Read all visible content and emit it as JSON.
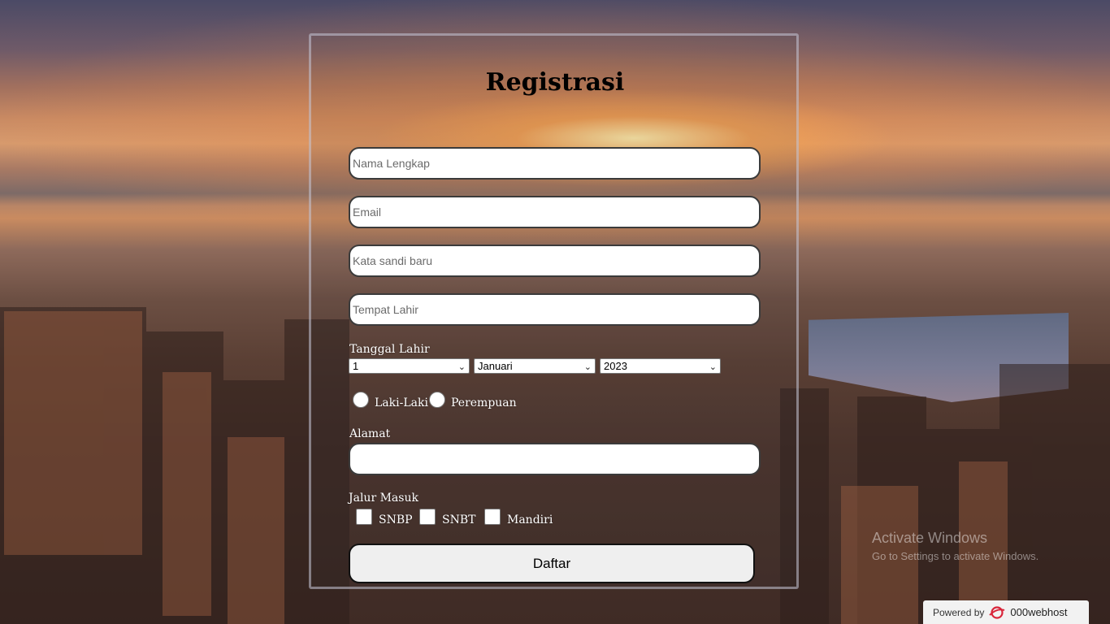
{
  "form": {
    "title": "Registrasi",
    "full_name_placeholder": "Nama Lengkap",
    "email_placeholder": "Email",
    "password_placeholder": "Kata sandi baru",
    "birthplace_placeholder": "Tempat Lahir",
    "birthdate_label": "Tanggal Lahir",
    "birth_day": "1",
    "birth_month": "Januari",
    "birth_year": "2023",
    "gender_male": "Laki-Laki",
    "gender_female": "Perempuan",
    "address_label": "Alamat",
    "address_value": "",
    "entry_label": "Jalur Masuk",
    "entry_options": [
      "SNBP",
      "SNBT",
      "Mandiri"
    ],
    "submit_label": "Daftar"
  },
  "os_watermark": {
    "line1": "Activate Windows",
    "line2": "Go to Settings to activate Windows."
  },
  "hosting_badge": {
    "prefix": "Powered by",
    "brand": "000webhost",
    "icon": "000webhost-logo-icon"
  }
}
